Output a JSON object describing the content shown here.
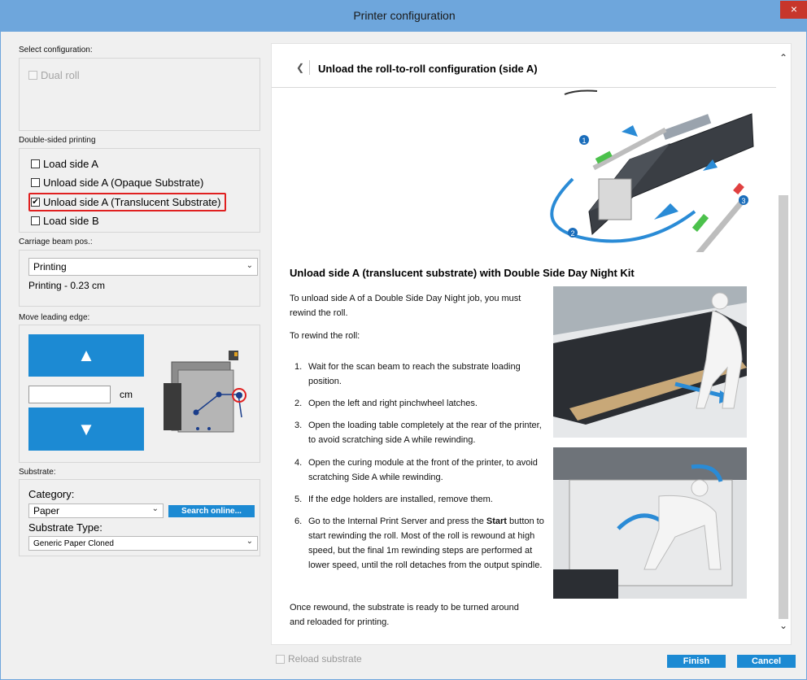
{
  "window": {
    "title": "Printer configuration",
    "close_glyph": "×"
  },
  "select_configuration": {
    "label": "Select configuration:",
    "dual_roll": "Dual roll"
  },
  "double_sided": {
    "label": "Double-sided printing",
    "options": [
      {
        "label": "Load side A",
        "checked": false
      },
      {
        "label": "Unload side A (Opaque Substrate)",
        "checked": false
      },
      {
        "label": "Unload side A (Translucent Substrate)",
        "checked": true
      },
      {
        "label": "Load side B",
        "checked": false
      }
    ],
    "check_glyph": "✔"
  },
  "carriage": {
    "label": "Carriage beam pos.:",
    "selected": "Printing",
    "readout": "Printing - 0.23 cm"
  },
  "leading_edge": {
    "label": "Move leading edge:",
    "up_glyph": "▲",
    "down_glyph": "▼",
    "unit": "cm",
    "value": ""
  },
  "substrate": {
    "label": "Substrate:",
    "category_label": "Category:",
    "category_value": "Paper",
    "search_button": "Search online...",
    "type_label": "Substrate Type:",
    "type_value": "Generic Paper Cloned"
  },
  "doc": {
    "back_glyph": "❮",
    "title": "Unload the roll-to-roll configuration (side A)",
    "heading": "Unload side A (translucent substrate) with Double Side Day Night Kit",
    "intro": "To unload side A of a Double Side Day Night job, you must rewind the roll.",
    "rewind_intro": "To rewind the roll:",
    "steps": [
      {
        "num": "1.",
        "text": "Wait for the scan beam to reach the substrate loading position."
      },
      {
        "num": "2.",
        "text": "Open the left and right pinchwheel latches."
      },
      {
        "num": "3.",
        "text": "Open the loading table completely at the rear of the printer, to avoid scratching side A while rewinding."
      },
      {
        "num": "4.",
        "text": "Open the curing module at the front of the printer, to avoid scratching Side A while rewinding."
      },
      {
        "num": "5.",
        "text": "If the edge holders are installed, remove them."
      },
      {
        "num": "6.",
        "text_pre": "Go to the Internal Print Server and press the ",
        "text_bold": "Start",
        "text_post": " button to start rewinding the roll. Most of the roll is rewound at high speed, but the final 1m rewinding steps are performed at lower speed, until the roll detaches from the output spindle."
      }
    ],
    "outro": "Once rewound, the substrate is ready to be turned around and reloaded for printing.",
    "diagram_markers": [
      "1",
      "2",
      "3"
    ],
    "scroll_up_glyph": "⌃",
    "scroll_down_glyph": "⌄"
  },
  "footer": {
    "reload_substrate": "Reload substrate",
    "finish": "Finish",
    "cancel": "Cancel"
  },
  "colors": {
    "title_bar": "#6ea6dc",
    "accent_blue": "#1c8ad3",
    "close_red": "#c7362b",
    "highlight_red": "#e02020",
    "machine_dark": "#2b2e33",
    "arrow_blue": "#2a8bd6"
  }
}
